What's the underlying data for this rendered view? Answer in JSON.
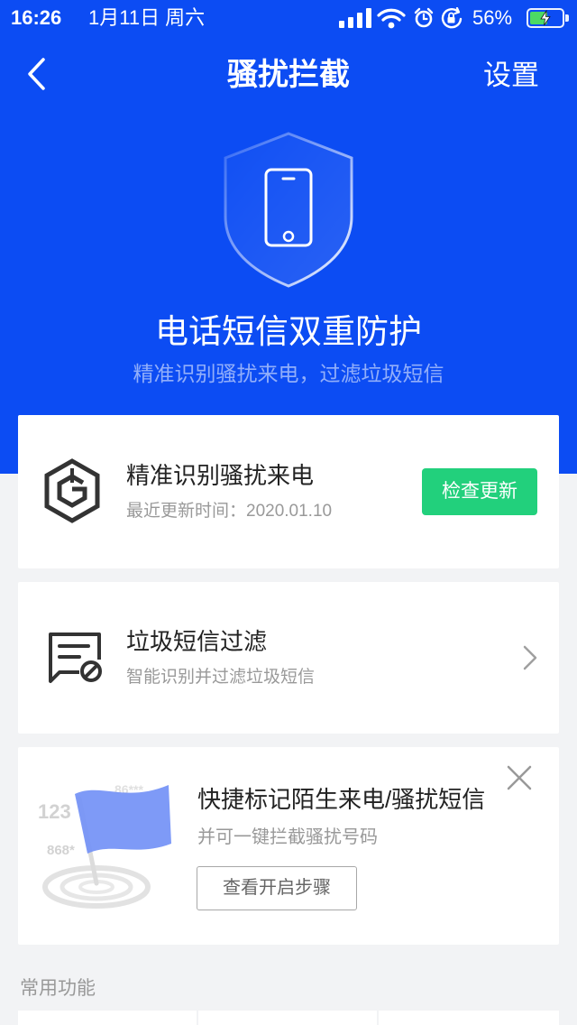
{
  "status_bar": {
    "time": "16:26",
    "date": "1月11日 周六",
    "battery_label": "56%",
    "battery_level": 0.56,
    "icons": [
      "signal-icon",
      "wifi-icon",
      "alarm-icon",
      "rotation-lock-icon",
      "battery-charging-icon"
    ]
  },
  "header": {
    "back_icon": "chevron-left-icon",
    "title": "骚扰拦截",
    "settings_label": "设置"
  },
  "hero": {
    "icon": "shield-phone-icon",
    "title": "电话短信双重防护",
    "subtitle": "精准识别骚扰来电，过滤垃圾短信"
  },
  "call_identify_card": {
    "icon": "hexagon-g-icon",
    "title": "精准识别骚扰来电",
    "update_text": "最近更新时间：2020.01.10",
    "button_label": "检查更新"
  },
  "sms_filter_card": {
    "icon": "message-block-icon",
    "title": "垃圾短信过滤",
    "subtitle": "智能识别并过滤垃圾短信",
    "arrow_icon": "chevron-right-icon"
  },
  "quick_mark_card": {
    "illustration_icon": "flag-radar-illustration",
    "illustration_numbers": [
      "123",
      "868*",
      "86***"
    ],
    "title": "快捷标记陌生来电/骚扰短信",
    "subtitle": "并可一键拦截骚扰号码",
    "button_label": "查看开启步骤",
    "close_icon": "close-icon"
  },
  "common_features": {
    "label": "常用功能"
  },
  "colors": {
    "primary_blue": "#0c4cf3",
    "update_green": "#22d07c",
    "battery_green": "#4cd964",
    "flag_blue": "#7391f6",
    "page_background": "#f2f3f5"
  }
}
